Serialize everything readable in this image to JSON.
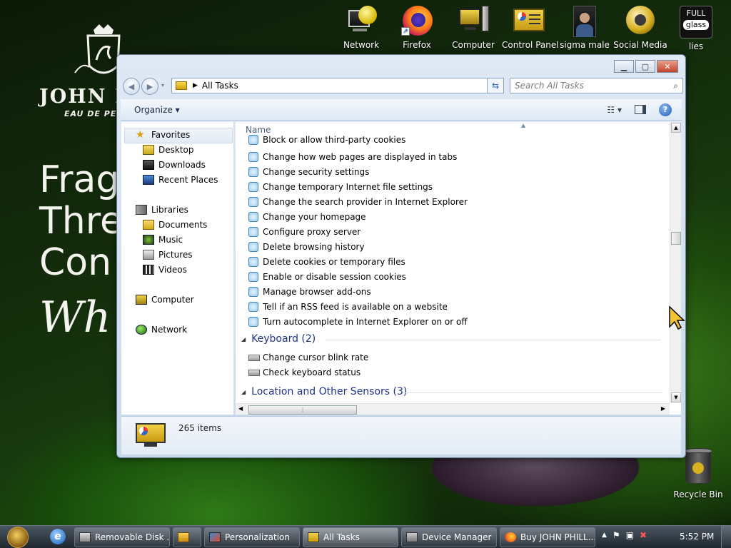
{
  "wallpaper": {
    "brand": "JOHN PH",
    "brand_sub": "EAU DE PE",
    "words": [
      "Frag",
      "Thre",
      "Con",
      "Wh"
    ]
  },
  "desktop_icons": [
    {
      "label": "Network",
      "icon": "network-globe-icon"
    },
    {
      "label": "Firefox",
      "icon": "firefox-icon"
    },
    {
      "label": "Computer",
      "icon": "computer-icon"
    },
    {
      "label": "Control Panel",
      "icon": "control-panel-icon"
    },
    {
      "label": "sigma male",
      "icon": "user-photo-icon"
    },
    {
      "label": "Social Media",
      "icon": "social-media-icon"
    },
    {
      "label": "lies",
      "icon": "full-glass-icon",
      "badge_top": "FULL",
      "badge_bottom": "glass"
    }
  ],
  "recycle_bin": {
    "label": "Recycle Bin"
  },
  "window": {
    "caption_buttons": {
      "minimize": "▁",
      "maximize": "▢",
      "close": "✕"
    },
    "address": {
      "location": "All Tasks"
    },
    "search": {
      "placeholder": "Search All Tasks"
    },
    "command_bar": {
      "organize": "Organize ▾"
    },
    "nav_pane": {
      "favorites": {
        "label": "Favorites",
        "items": [
          "Desktop",
          "Downloads",
          "Recent Places"
        ]
      },
      "libraries": {
        "label": "Libraries",
        "items": [
          "Documents",
          "Music",
          "Pictures",
          "Videos"
        ]
      },
      "computer": "Computer",
      "network": "Network"
    },
    "content": {
      "column_header": "Name",
      "internet_tasks": [
        "Block or allow third-party cookies",
        "Change how web pages are displayed in tabs",
        "Change security settings",
        "Change temporary Internet file settings",
        "Change the search provider in Internet Explorer",
        "Change your homepage",
        "Configure proxy server",
        "Delete browsing history",
        "Delete cookies or temporary files",
        "Enable or disable session cookies",
        "Manage browser add-ons",
        "Tell if an RSS feed is available on a website",
        "Turn autocomplete in Internet Explorer on or off"
      ],
      "groups": [
        {
          "title": "Keyboard (2)",
          "items": [
            "Change cursor blink rate",
            "Check keyboard status"
          ]
        },
        {
          "title": "Location and Other Sensors (3)"
        }
      ]
    },
    "details": {
      "count": "265 items"
    }
  },
  "taskbar": {
    "buttons": [
      {
        "label": "Removable Disk ...",
        "icon": "removable-disk-icon"
      },
      {
        "label": "",
        "icon": "media-player-icon"
      },
      {
        "label": "Personalization",
        "icon": "personalization-icon"
      },
      {
        "label": "All Tasks",
        "icon": "control-panel-icon",
        "active": true
      },
      {
        "label": "Device Manager",
        "icon": "device-manager-icon"
      },
      {
        "label": "Buy JOHN PHILL...",
        "icon": "firefox-icon"
      }
    ],
    "clock": "5:52 PM"
  }
}
